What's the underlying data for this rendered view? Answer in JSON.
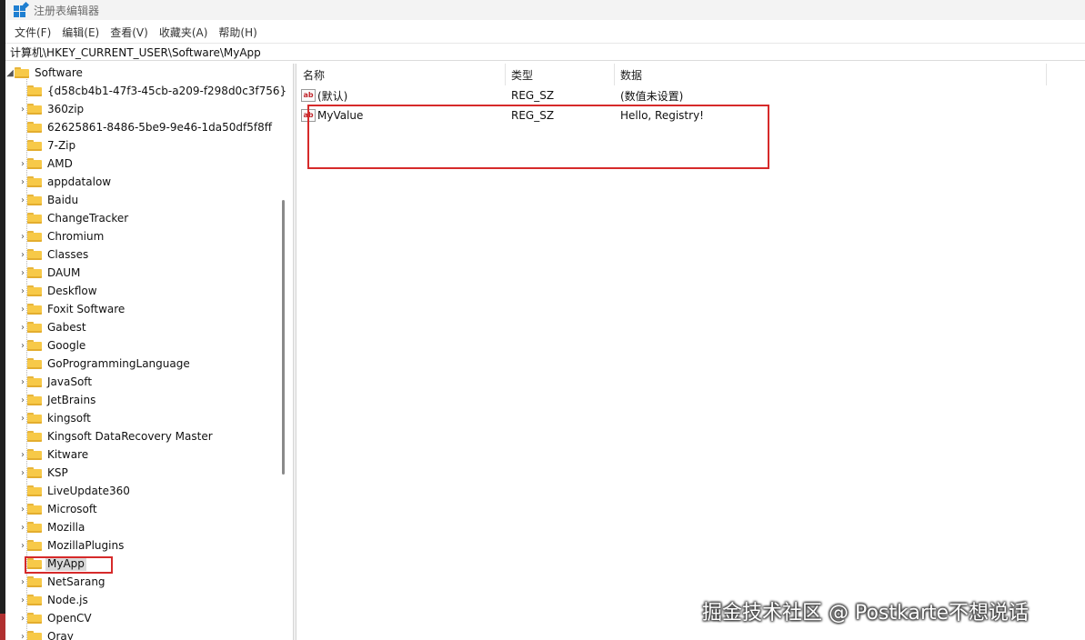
{
  "window": {
    "title": "注册表编辑器"
  },
  "menu": [
    "文件(F)",
    "编辑(E)",
    "查看(V)",
    "收藏夹(A)",
    "帮助(H)"
  ],
  "address": "计算机\\HKEY_CURRENT_USER\\Software\\MyApp",
  "tree": {
    "root": {
      "label": "Software",
      "expanded": true
    },
    "items": [
      {
        "label": "{d58cb4b1-47f3-45cb-a209-f298d0c3f756}",
        "has_children": false
      },
      {
        "label": "360zip",
        "has_children": true
      },
      {
        "label": "62625861-8486-5be9-9e46-1da50df5f8ff",
        "has_children": false
      },
      {
        "label": "7-Zip",
        "has_children": false
      },
      {
        "label": "AMD",
        "has_children": true
      },
      {
        "label": "appdatalow",
        "has_children": true
      },
      {
        "label": "Baidu",
        "has_children": true
      },
      {
        "label": "ChangeTracker",
        "has_children": false
      },
      {
        "label": "Chromium",
        "has_children": true
      },
      {
        "label": "Classes",
        "has_children": true
      },
      {
        "label": "DAUM",
        "has_children": true
      },
      {
        "label": "Deskflow",
        "has_children": true
      },
      {
        "label": "Foxit Software",
        "has_children": true
      },
      {
        "label": "Gabest",
        "has_children": true
      },
      {
        "label": "Google",
        "has_children": true
      },
      {
        "label": "GoProgrammingLanguage",
        "has_children": false
      },
      {
        "label": "JavaSoft",
        "has_children": true
      },
      {
        "label": "JetBrains",
        "has_children": true
      },
      {
        "label": "kingsoft",
        "has_children": true
      },
      {
        "label": "Kingsoft DataRecovery Master",
        "has_children": false
      },
      {
        "label": "Kitware",
        "has_children": true
      },
      {
        "label": "KSP",
        "has_children": true
      },
      {
        "label": "LiveUpdate360",
        "has_children": false
      },
      {
        "label": "Microsoft",
        "has_children": true
      },
      {
        "label": "Mozilla",
        "has_children": true
      },
      {
        "label": "MozillaPlugins",
        "has_children": true
      },
      {
        "label": "MyApp",
        "has_children": false,
        "selected": true
      },
      {
        "label": "NetSarang",
        "has_children": true
      },
      {
        "label": "Node.js",
        "has_children": true
      },
      {
        "label": "OpenCV",
        "has_children": true
      },
      {
        "label": "Oray",
        "has_children": true
      }
    ]
  },
  "values_pane": {
    "columns": [
      "名称",
      "类型",
      "数据"
    ],
    "rows": [
      {
        "name": "(默认)",
        "type": "REG_SZ",
        "data": "(数值未设置)",
        "icon": "string-value-icon"
      },
      {
        "name": "MyValue",
        "type": "REG_SZ",
        "data": "Hello, Registry!",
        "icon": "string-value-icon"
      }
    ]
  },
  "watermark": "掘金技术社区 @ Postkarte不想说话",
  "colors": {
    "highlight_border": "#d62a2a",
    "folder": "#f7c948",
    "selection": "#d9d9d9"
  }
}
